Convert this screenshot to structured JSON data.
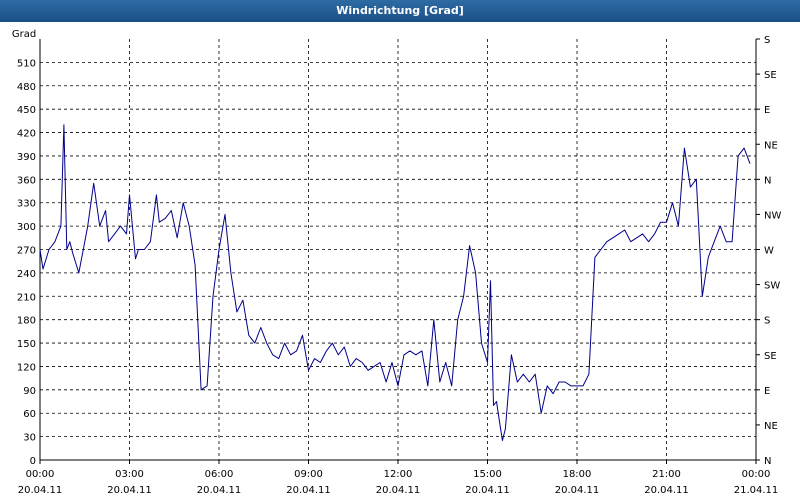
{
  "window": {
    "title": "Windrichtung [Grad]"
  },
  "chart_data": {
    "type": "line",
    "title": "Windrichtung [Grad]",
    "ylabel": "Grad",
    "ylim": [
      0,
      540
    ],
    "y_ticks": [
      0,
      30,
      60,
      90,
      120,
      150,
      180,
      210,
      240,
      270,
      300,
      330,
      360,
      390,
      420,
      450,
      480,
      510
    ],
    "right_axis_labels": [
      "N",
      "NE",
      "E",
      "SE",
      "S",
      "SW",
      "W",
      "NW",
      "N",
      "NE",
      "E",
      "SE",
      "S"
    ],
    "x_ticks": [
      {
        "time": "00:00",
        "date": "20.04.11"
      },
      {
        "time": "03:00",
        "date": "20.04.11"
      },
      {
        "time": "06:00",
        "date": "20.04.11"
      },
      {
        "time": "09:00",
        "date": "20.04.11"
      },
      {
        "time": "12:00",
        "date": "20.04.11"
      },
      {
        "time": "15:00",
        "date": "20.04.11"
      },
      {
        "time": "18:00",
        "date": "20.04.11"
      },
      {
        "time": "21:00",
        "date": "20.04.11"
      },
      {
        "time": "00:00",
        "date": "21.04.11"
      }
    ],
    "xlim_hours": [
      0,
      24
    ],
    "grid": true,
    "line_color": "#00008b",
    "series": [
      {
        "x_hours": [
          0.0,
          0.1,
          0.3,
          0.5,
          0.7,
          0.8,
          0.9,
          1.0,
          1.1,
          1.3,
          1.5,
          1.6,
          1.8,
          2.0,
          2.2,
          2.3,
          2.5,
          2.7,
          2.9,
          3.0,
          3.2,
          3.3,
          3.5,
          3.7,
          3.9,
          4.0,
          4.2,
          4.4,
          4.6,
          4.8,
          5.0,
          5.2,
          5.4,
          5.6,
          5.8,
          6.0,
          6.2,
          6.4,
          6.6,
          6.8,
          7.0,
          7.2,
          7.4,
          7.6,
          7.8,
          8.0,
          8.2,
          8.4,
          8.6,
          8.8,
          9.0,
          9.2,
          9.4,
          9.6,
          9.8,
          10.0,
          10.2,
          10.4,
          10.6,
          10.8,
          11.0,
          11.2,
          11.4,
          11.6,
          11.8,
          12.0,
          12.2,
          12.4,
          12.6,
          12.8,
          13.0,
          13.2,
          13.4,
          13.6,
          13.8,
          14.0,
          14.2,
          14.4,
          14.6,
          14.8,
          15.0,
          15.1,
          15.2,
          15.3,
          15.4,
          15.5,
          15.6,
          15.8,
          16.0,
          16.2,
          16.4,
          16.6,
          16.8,
          17.0,
          17.2,
          17.4,
          17.6,
          17.8,
          18.0,
          18.2,
          18.4,
          18.6,
          18.8,
          19.0,
          19.2,
          19.4,
          19.6,
          19.8,
          20.0,
          20.2,
          20.4,
          20.6,
          20.8,
          21.0,
          21.2,
          21.4,
          21.6,
          21.8,
          22.0,
          22.2,
          22.4,
          22.6,
          22.8,
          23.0,
          23.2,
          23.4,
          23.6,
          23.8,
          24.0
        ],
        "values": [
          270,
          245,
          270,
          280,
          300,
          430,
          270,
          280,
          265,
          240,
          280,
          300,
          355,
          300,
          320,
          280,
          290,
          300,
          290,
          340,
          258,
          270,
          270,
          280,
          340,
          305,
          310,
          320,
          285,
          330,
          300,
          250,
          90,
          95,
          210,
          270,
          315,
          240,
          190,
          205,
          160,
          150,
          170,
          150,
          135,
          130,
          150,
          135,
          140,
          160,
          115,
          130,
          125,
          140,
          150,
          135,
          145,
          120,
          130,
          125,
          115,
          120,
          125,
          100,
          125,
          95,
          135,
          140,
          135,
          140,
          95,
          180,
          100,
          125,
          95,
          180,
          210,
          275,
          240,
          150,
          125,
          230,
          70,
          75,
          50,
          25,
          40,
          135,
          100,
          110,
          100,
          110,
          60,
          95,
          85,
          100,
          100,
          95,
          95,
          95,
          110,
          260,
          270,
          280,
          285,
          290,
          295,
          280,
          285,
          290,
          280,
          290,
          305,
          305,
          330,
          300,
          400,
          350,
          360,
          210,
          260,
          280,
          300,
          280,
          280,
          390,
          400,
          380
        ]
      }
    ]
  }
}
